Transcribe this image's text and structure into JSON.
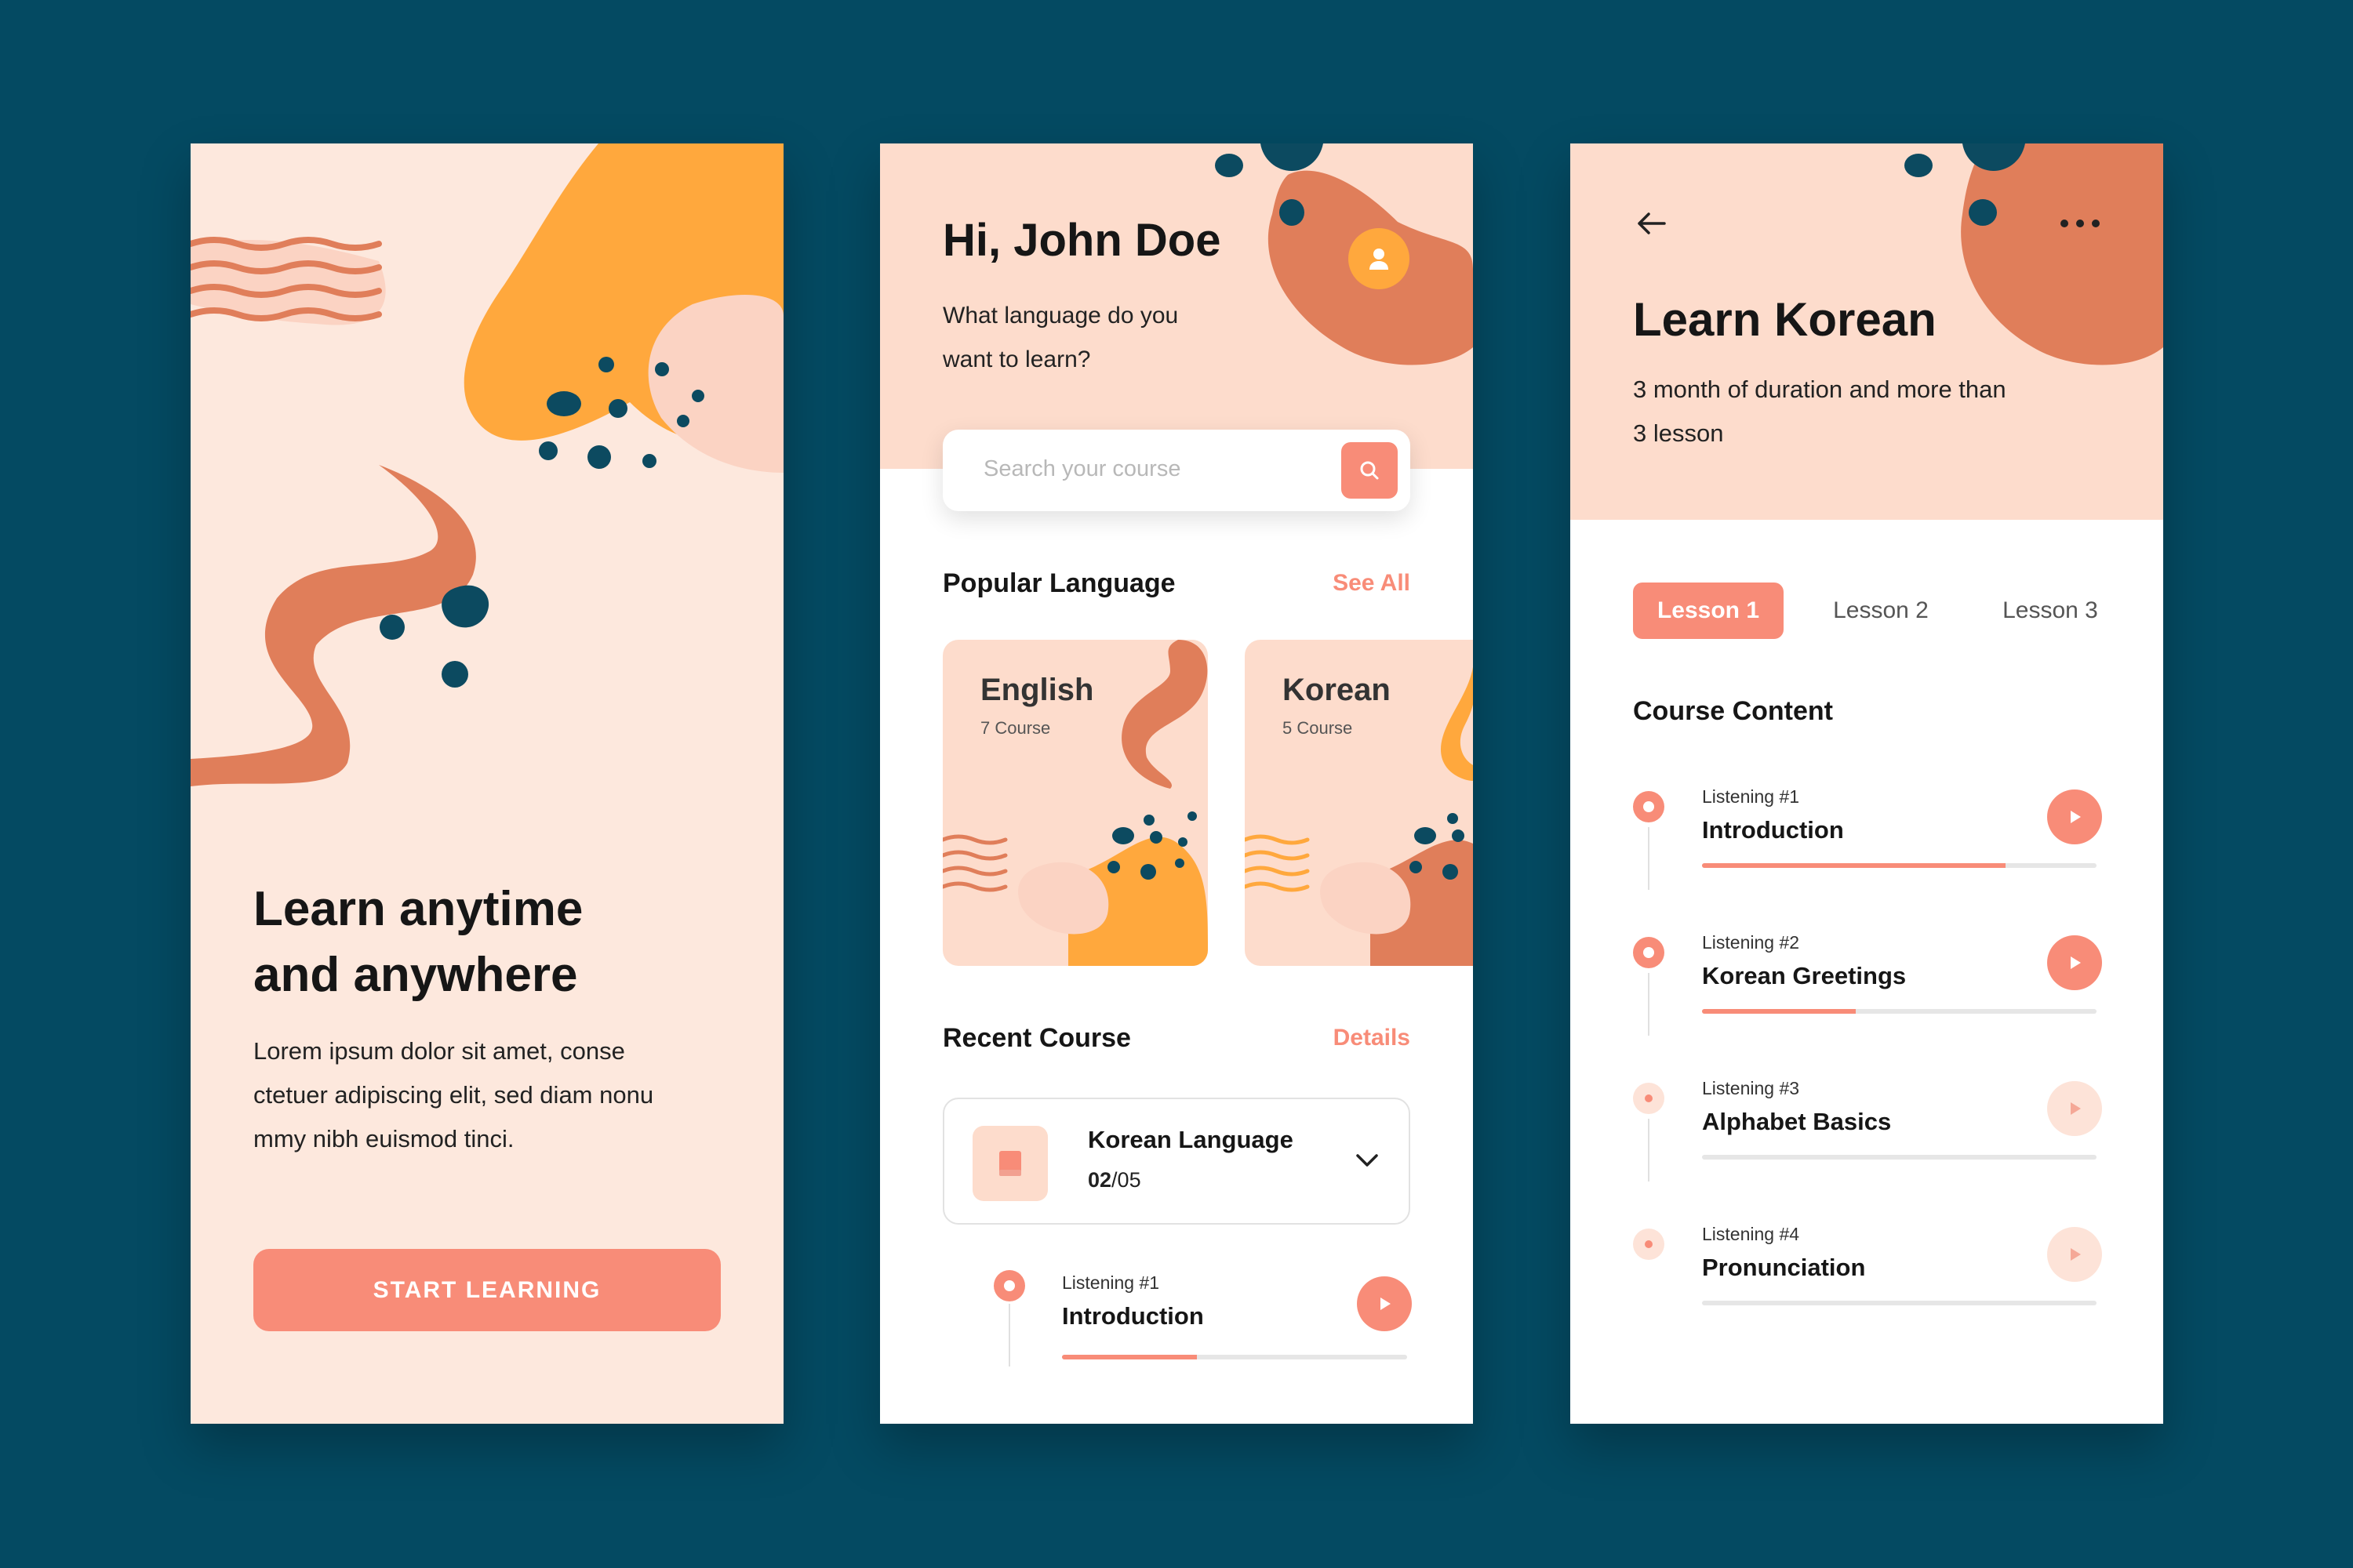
{
  "screen1": {
    "title_line1": "Learn anytime",
    "title_line2": "and anywhere",
    "body_line1": "Lorem ipsum dolor sit amet, conse",
    "body_line2": "ctetuer adipiscing elit, sed diam nonu",
    "body_line3": "mmy nibh euismod tinci.",
    "cta_label": "START LEARNING"
  },
  "screen2": {
    "greeting": "Hi, John Doe",
    "question_line1": "What language do you",
    "question_line2": "want to learn?",
    "search_placeholder": "Search your course",
    "popular_heading": "Popular Language",
    "see_all_label": "See All",
    "languages": [
      {
        "name": "English",
        "count": "7 Course"
      },
      {
        "name": "Korean",
        "count": "5 Course"
      }
    ],
    "recent_heading": "Recent Course",
    "details_label": "Details",
    "recent_course": {
      "title": "Korean Language",
      "progress_current": "02",
      "progress_total": "/05"
    },
    "lesson": {
      "subtitle": "Listening #1",
      "title": "Introduction",
      "progress": 0.39
    }
  },
  "screen3": {
    "title": "Learn Korean",
    "subtitle_line1": "3 month of duration and more than",
    "subtitle_line2": "3 lesson",
    "tabs": [
      "Lesson 1",
      "Lesson 2",
      "Lesson 3"
    ],
    "active_tab": 0,
    "content_heading": "Course Content",
    "lessons": [
      {
        "subtitle": "Listening #1",
        "title": "Introduction",
        "progress": 0.77,
        "active": true
      },
      {
        "subtitle": "Listening #2",
        "title": "Korean Greetings",
        "progress": 0.39,
        "active": true
      },
      {
        "subtitle": "Listening #3",
        "title": "Alphabet Basics",
        "progress": 0,
        "active": false
      },
      {
        "subtitle": "Listening #4",
        "title": "Pronunciation",
        "progress": 0,
        "active": false
      }
    ]
  },
  "colors": {
    "background": "#044a62",
    "accent": "#f88c78",
    "peach": "#fddccc",
    "orange": "#ffa83d",
    "terracotta": "#e07e5a",
    "navy": "#0c4a60"
  },
  "icons": [
    "user-icon",
    "search-icon",
    "book-icon",
    "chevron-down-icon",
    "play-icon",
    "back-arrow-icon",
    "more-icon"
  ]
}
